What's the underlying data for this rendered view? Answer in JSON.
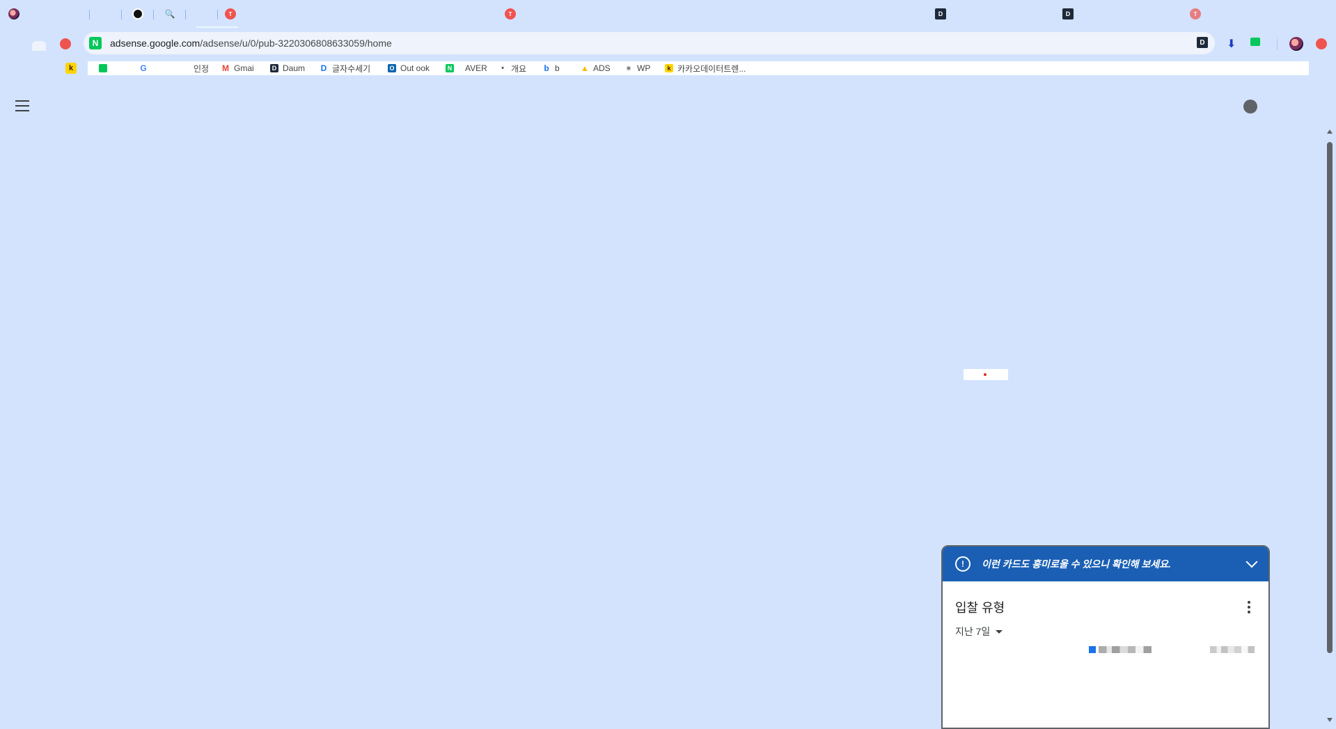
{
  "omnibox": {
    "host": "adsense.google.com",
    "path": "/adsense/u/0/pub-3220306808633059/home",
    "site_icon": "N"
  },
  "bookmarks": [
    {
      "label": "",
      "icon": "green-chat-icon",
      "color": "#03c75a"
    },
    {
      "label": "",
      "icon": "google-icon",
      "color": "#ffffff"
    },
    {
      "label": "인정",
      "icon": "none",
      "color": ""
    },
    {
      "label": "Gmai",
      "icon": "gmail-icon",
      "color": "#ffffff"
    },
    {
      "label": "Daum",
      "icon": "daum-icon",
      "color": "#1e2a3a"
    },
    {
      "label": "글자수세기",
      "icon": "d-icon",
      "color": "#1a73e8"
    },
    {
      "label": "Out ook",
      "icon": "outlook-icon",
      "color": "#0a64ad"
    },
    {
      "label": "AVER",
      "icon": "naver-icon",
      "color": "#03c75a"
    },
    {
      "label": "개요",
      "icon": "tistory-icon",
      "color": "#ffffff"
    },
    {
      "label": "b",
      "icon": "bing-icon",
      "color": "#ffffff"
    },
    {
      "label": "ADS",
      "icon": "google-ads-icon",
      "color": "#ffffff"
    },
    {
      "label": "WP",
      "icon": "wp-icon",
      "color": "#ffffff"
    },
    {
      "label": "카카오데이터트렌...",
      "icon": "kakao-icon",
      "color": "#ffd400"
    }
  ],
  "card": {
    "banner_text": "이런 카드도 흥미로울 수 있으니 확인해 보세요.",
    "title": "입찰 유형",
    "period": "지난 7일"
  },
  "colors": {
    "page_bg": "#d3e3fd",
    "banner_bg": "#1a5fb4",
    "accent": "#1a73e8"
  }
}
